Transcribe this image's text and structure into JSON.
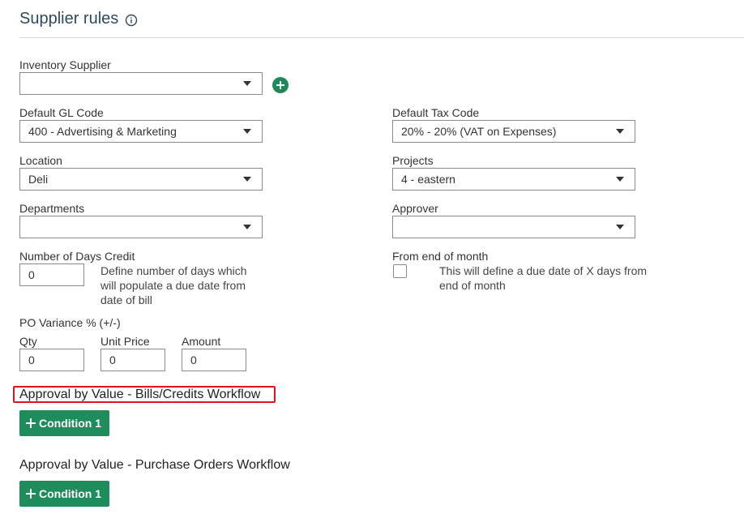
{
  "page": {
    "title": "Supplier rules"
  },
  "inventory_supplier": {
    "label": "Inventory Supplier",
    "value": ""
  },
  "default_gl_code": {
    "label": "Default GL Code",
    "value": "400 - Advertising & Marketing"
  },
  "default_tax_code": {
    "label": "Default Tax Code",
    "value": "20% - 20% (VAT on Expenses)"
  },
  "location": {
    "label": "Location",
    "value": "Deli"
  },
  "projects": {
    "label": "Projects",
    "value": "4 - eastern"
  },
  "departments": {
    "label": "Departments",
    "value": ""
  },
  "approver": {
    "label": "Approver",
    "value": ""
  },
  "days_credit": {
    "label": "Number of Days Credit",
    "value": "0",
    "help": "Define number of days which will populate a due date from date of bill"
  },
  "end_of_month": {
    "label": "From end of month",
    "checked": false,
    "help": "This will define a due date of X days from end of month"
  },
  "po_variance": {
    "label": "PO Variance % (+/-)",
    "qty_label": "Qty",
    "qty_value": "0",
    "unit_price_label": "Unit Price",
    "unit_price_value": "0",
    "amount_label": "Amount",
    "amount_value": "0"
  },
  "bills_workflow": {
    "heading": "Approval by Value - Bills/Credits Workflow",
    "button_label": "Condition 1",
    "highlight_color": "#e0141e"
  },
  "po_workflow": {
    "heading": "Approval by Value - Purchase Orders Workflow",
    "button_label": "Condition 1"
  },
  "icons": {
    "info": "info-icon",
    "add": "plus-circle-icon",
    "dropdown": "chevron-down-icon",
    "button_plus": "plus-icon"
  },
  "colors": {
    "accent": "#1f8c5c",
    "title": "#2c4a5e"
  }
}
